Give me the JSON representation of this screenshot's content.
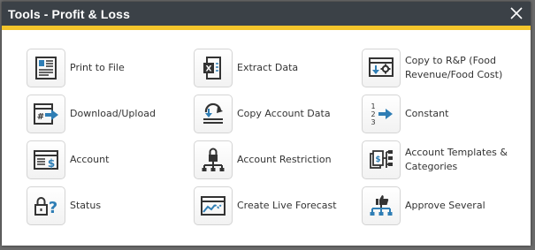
{
  "dialog": {
    "title": "Tools - Profit & Loss",
    "close_icon": "close-icon"
  },
  "colors": {
    "titlebar": "#3b4147",
    "accent_stripe": "#f4c52b",
    "icon_dark": "#333333",
    "icon_accent": "#2f7eb5"
  },
  "tools": [
    {
      "label": "Print to File",
      "icon": "print-to-file-icon"
    },
    {
      "label": "Extract Data",
      "icon": "excel-extract-icon"
    },
    {
      "label": "Copy to R&P (Food\nRevenue/Food Cost)",
      "icon": "copy-settings-icon"
    },
    {
      "label": "Download/Upload",
      "icon": "download-upload-icon"
    },
    {
      "label": "Copy Account Data",
      "icon": "copy-data-icon"
    },
    {
      "label": "Constant",
      "icon": "numbered-list-icon"
    },
    {
      "label": "Account",
      "icon": "account-icon"
    },
    {
      "label": "Account Restriction",
      "icon": "restriction-icon"
    },
    {
      "label": "Account Templates &\nCategories",
      "icon": "templates-icon"
    },
    {
      "label": "Status",
      "icon": "lock-question-icon"
    },
    {
      "label": "Create Live Forecast",
      "icon": "forecast-icon"
    },
    {
      "label": "Approve Several",
      "icon": "approve-icon"
    }
  ]
}
